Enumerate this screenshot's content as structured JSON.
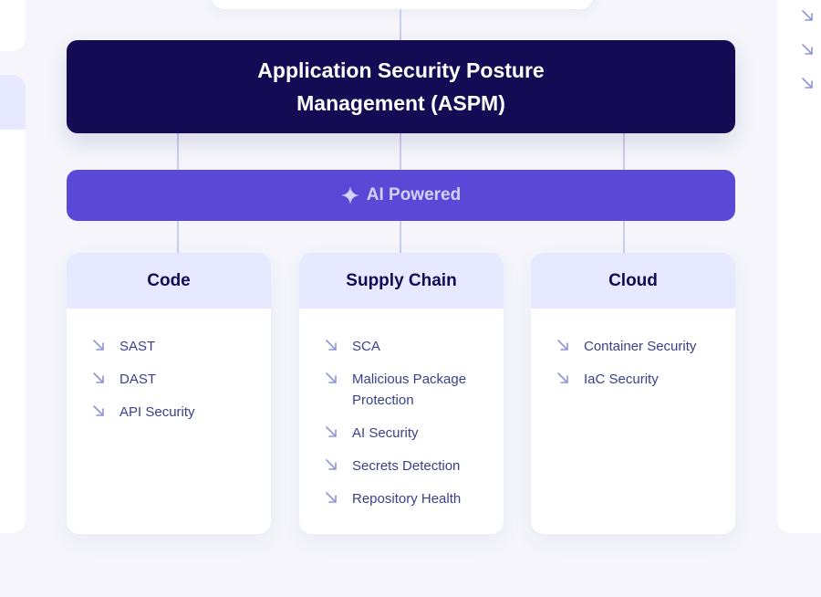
{
  "colors": {
    "navy": "#140b55",
    "purple": "#5b48d6",
    "card_header": "#e6e9ff",
    "item_text": "#3b3f8a",
    "arrow": "#8f94d8",
    "page_background": "#f5f5fb"
  },
  "aspm": {
    "title": "Application Security Posture Management (ASPM)"
  },
  "ai_bar": {
    "icon": "sparkle-icon",
    "label": "AI Powered"
  },
  "item_icon": "arrow-down-right-icon",
  "cards": [
    {
      "title": "Code",
      "items": [
        "SAST",
        "DAST",
        "API Security"
      ]
    },
    {
      "title": "Supply Chain",
      "items": [
        "SCA",
        "Malicious Package Protection",
        "AI Security",
        "Secrets Detection",
        "Repository Health"
      ]
    },
    {
      "title": "Cloud",
      "items": [
        "Container Security",
        "IaC Security"
      ]
    }
  ]
}
